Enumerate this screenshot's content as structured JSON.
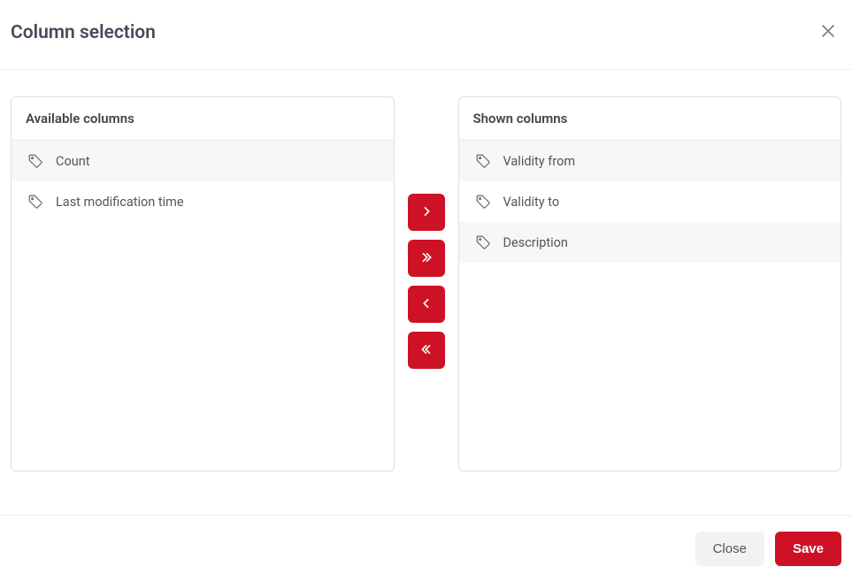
{
  "dialog": {
    "title": "Column selection"
  },
  "panels": {
    "available": {
      "header": "Available columns",
      "items": [
        "Count",
        "Last modification time"
      ]
    },
    "shown": {
      "header": "Shown columns",
      "items": [
        "Validity from",
        "Validity to",
        "Description"
      ]
    }
  },
  "footer": {
    "close": "Close",
    "save": "Save"
  }
}
